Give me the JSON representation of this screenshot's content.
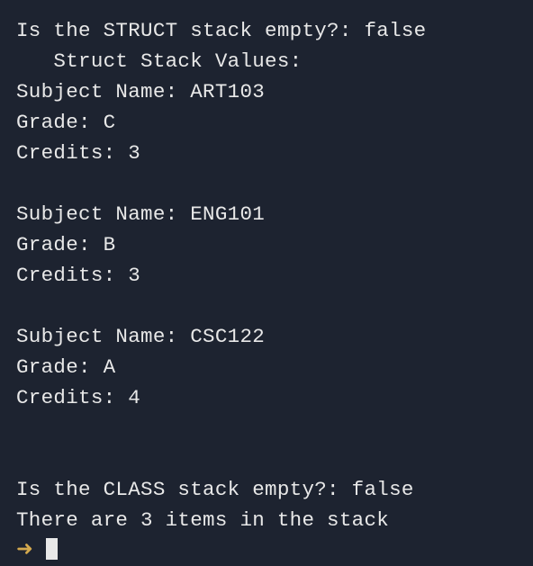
{
  "lines": {
    "struct_empty_prefix": "Is the STRUCT stack empty?: ",
    "struct_empty_value": "false",
    "struct_header": "   Struct Stack Values:",
    "entry1_subject_label": "Subject Name: ",
    "entry1_subject_value": "ART103",
    "entry1_grade_label": "Grade: ",
    "entry1_grade_value": "C",
    "entry1_credits_label": "Credits: ",
    "entry1_credits_value": "3",
    "entry2_subject_label": "Subject Name: ",
    "entry2_subject_value": "ENG101",
    "entry2_grade_label": "Grade: ",
    "entry2_grade_value": "B",
    "entry2_credits_label": "Credits: ",
    "entry2_credits_value": "3",
    "entry3_subject_label": "Subject Name: ",
    "entry3_subject_value": "CSC122",
    "entry3_grade_label": "Grade: ",
    "entry3_grade_value": "A",
    "entry3_credits_label": "Credits: ",
    "entry3_credits_value": "4",
    "class_empty_prefix": "Is the CLASS stack empty?: ",
    "class_empty_value": "false",
    "class_count_line": "There are 3 items in the stack",
    "prompt_char": "➜"
  }
}
